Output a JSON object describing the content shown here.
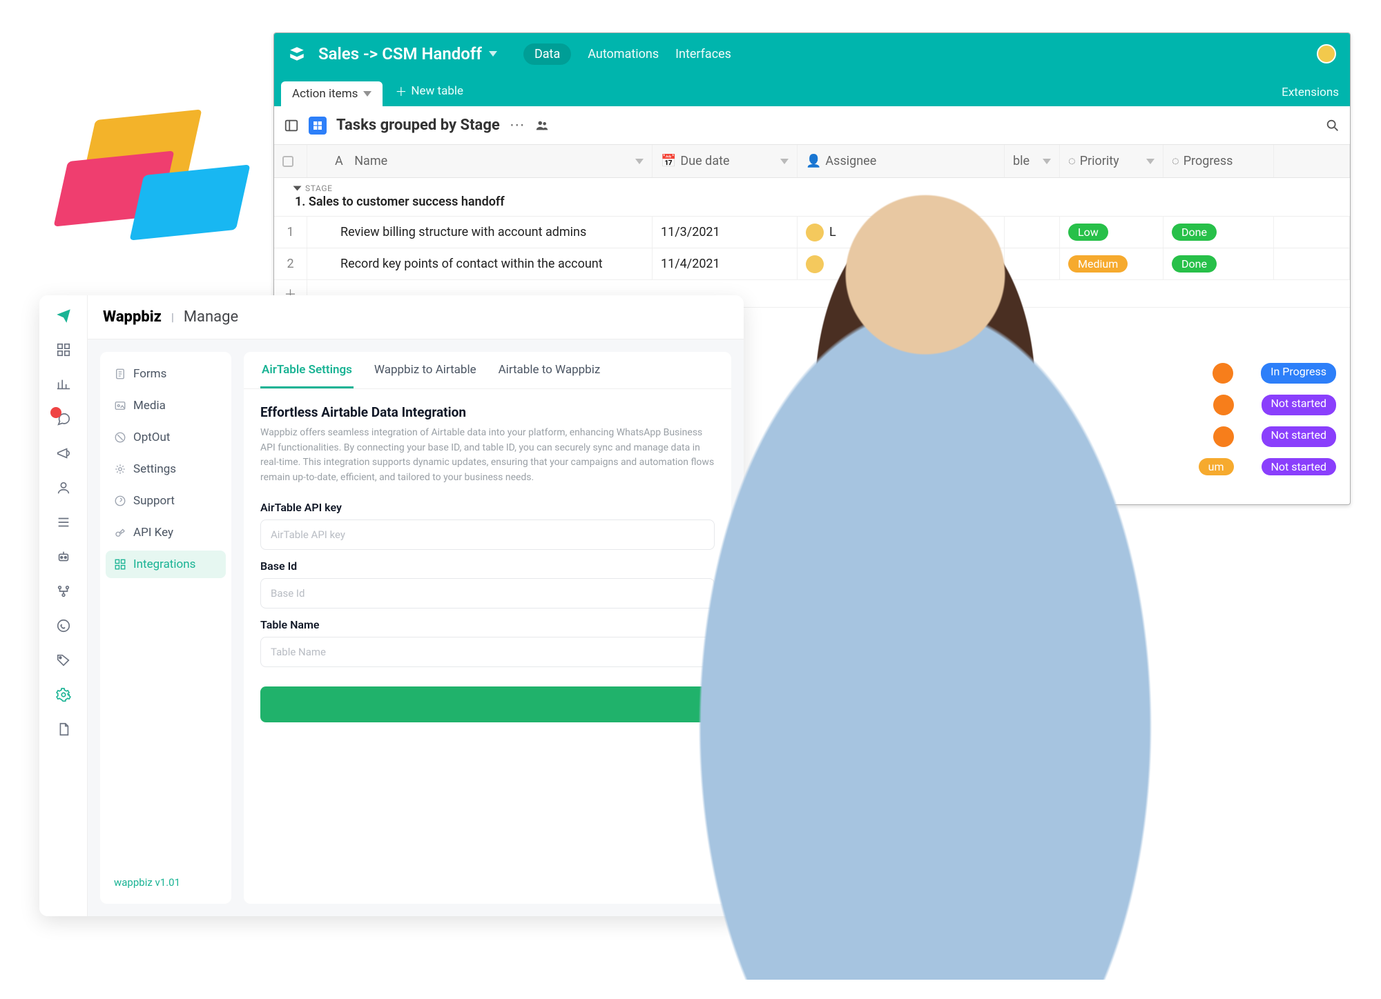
{
  "airtable": {
    "title": "Sales -> CSM Handoff",
    "nav": {
      "data": "Data",
      "automations": "Automations",
      "interfaces": "Interfaces"
    },
    "tab": "Action items",
    "new_table": "New table",
    "extensions": "Extensions",
    "view_name": "Tasks grouped by Stage",
    "columns": {
      "name": "Name",
      "due": "Due date",
      "assignee": "Assignee",
      "ble": "ble",
      "priority": "Priority",
      "progress": "Progress"
    },
    "group": {
      "label": "STAGE",
      "name": "1. Sales to customer success handoff"
    },
    "rows": [
      {
        "n": "1",
        "name": "Review billing structure with account admins",
        "due": "11/3/2021",
        "assignee": "L",
        "priority": "Low",
        "priority_class": "low",
        "progress": "Done",
        "progress_class": "done"
      },
      {
        "n": "2",
        "name": "Record key points of contact within the account",
        "due": "11/4/2021",
        "assignee": "",
        "priority": "Medium",
        "priority_class": "med",
        "progress": "Done",
        "progress_class": "done"
      }
    ],
    "extra_pills": [
      {
        "progress": "In Progress",
        "progress_class": "prog",
        "show_orange": true
      },
      {
        "progress": "Not started",
        "progress_class": "ns",
        "show_orange": true
      },
      {
        "progress": "Not started",
        "progress_class": "ns",
        "show_orange": true
      },
      {
        "progress": "Not started",
        "progress_class": "ns",
        "priority": "um",
        "show_orange": false
      }
    ]
  },
  "wappbiz": {
    "brand": "Wappbiz",
    "sub": "Manage",
    "version": "wappbiz v1.01",
    "side": [
      {
        "label": "Forms"
      },
      {
        "label": "Media"
      },
      {
        "label": "OptOut"
      },
      {
        "label": "Settings"
      },
      {
        "label": "Support"
      },
      {
        "label": "API Key"
      },
      {
        "label": "Integrations",
        "active": true
      }
    ],
    "tabs": [
      {
        "label": "AirTable Settings",
        "active": true
      },
      {
        "label": "Wappbiz to Airtable"
      },
      {
        "label": "Airtable to Wappbiz"
      }
    ],
    "section": {
      "heading": "Effortless Airtable Data Integration",
      "desc": "Wappbiz offers seamless integration of Airtable data into your platform, enhancing WhatsApp Business API functionalities. By connecting your base ID, and table ID, you can securely sync and manage data in real-time. This integration supports dynamic updates, ensuring that your campaigns and automation flows remain up-to-date, efficient, and tailored to your business needs.",
      "fields": {
        "api_key": {
          "label": "AirTable API key",
          "placeholder": "AirTable API key"
        },
        "base_id": {
          "label": "Base Id",
          "placeholder": "Base Id"
        },
        "table": {
          "label": "Table Name",
          "placeholder": "Table Name"
        }
      }
    }
  }
}
